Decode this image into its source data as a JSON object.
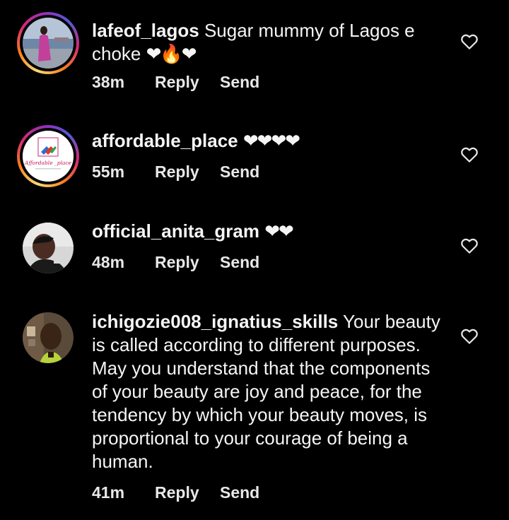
{
  "comments": [
    {
      "username": "lafeof_lagos",
      "text": "Sugar mummy of Lagos e choke",
      "emoji": "❤🔥❤",
      "time": "38m",
      "reply_label": "Reply",
      "send_label": "Send"
    },
    {
      "username": "affordable_place",
      "text": "",
      "emoji": "❤❤❤❤",
      "time": "55m",
      "reply_label": "Reply",
      "send_label": "Send",
      "avatar_logo_text": "Affordable _place"
    },
    {
      "username": "official_anita_gram",
      "text": "",
      "emoji": "❤❤",
      "time": "48m",
      "reply_label": "Reply",
      "send_label": "Send"
    },
    {
      "username": "ichigozie008_ignatius_skills",
      "text": "Your beauty is called according to different purposes. May you understand that the components of your beauty are joy and peace, for the tendency by which your beauty moves, is proportional to your courage of being a human.",
      "emoji": "",
      "time": "41m",
      "reply_label": "Reply",
      "send_label": "Send"
    }
  ],
  "icons": {
    "like": "heart-outline-icon"
  },
  "colors": {
    "background": "#000000",
    "text": "#f5f5f5",
    "heart": "#e0102a"
  }
}
